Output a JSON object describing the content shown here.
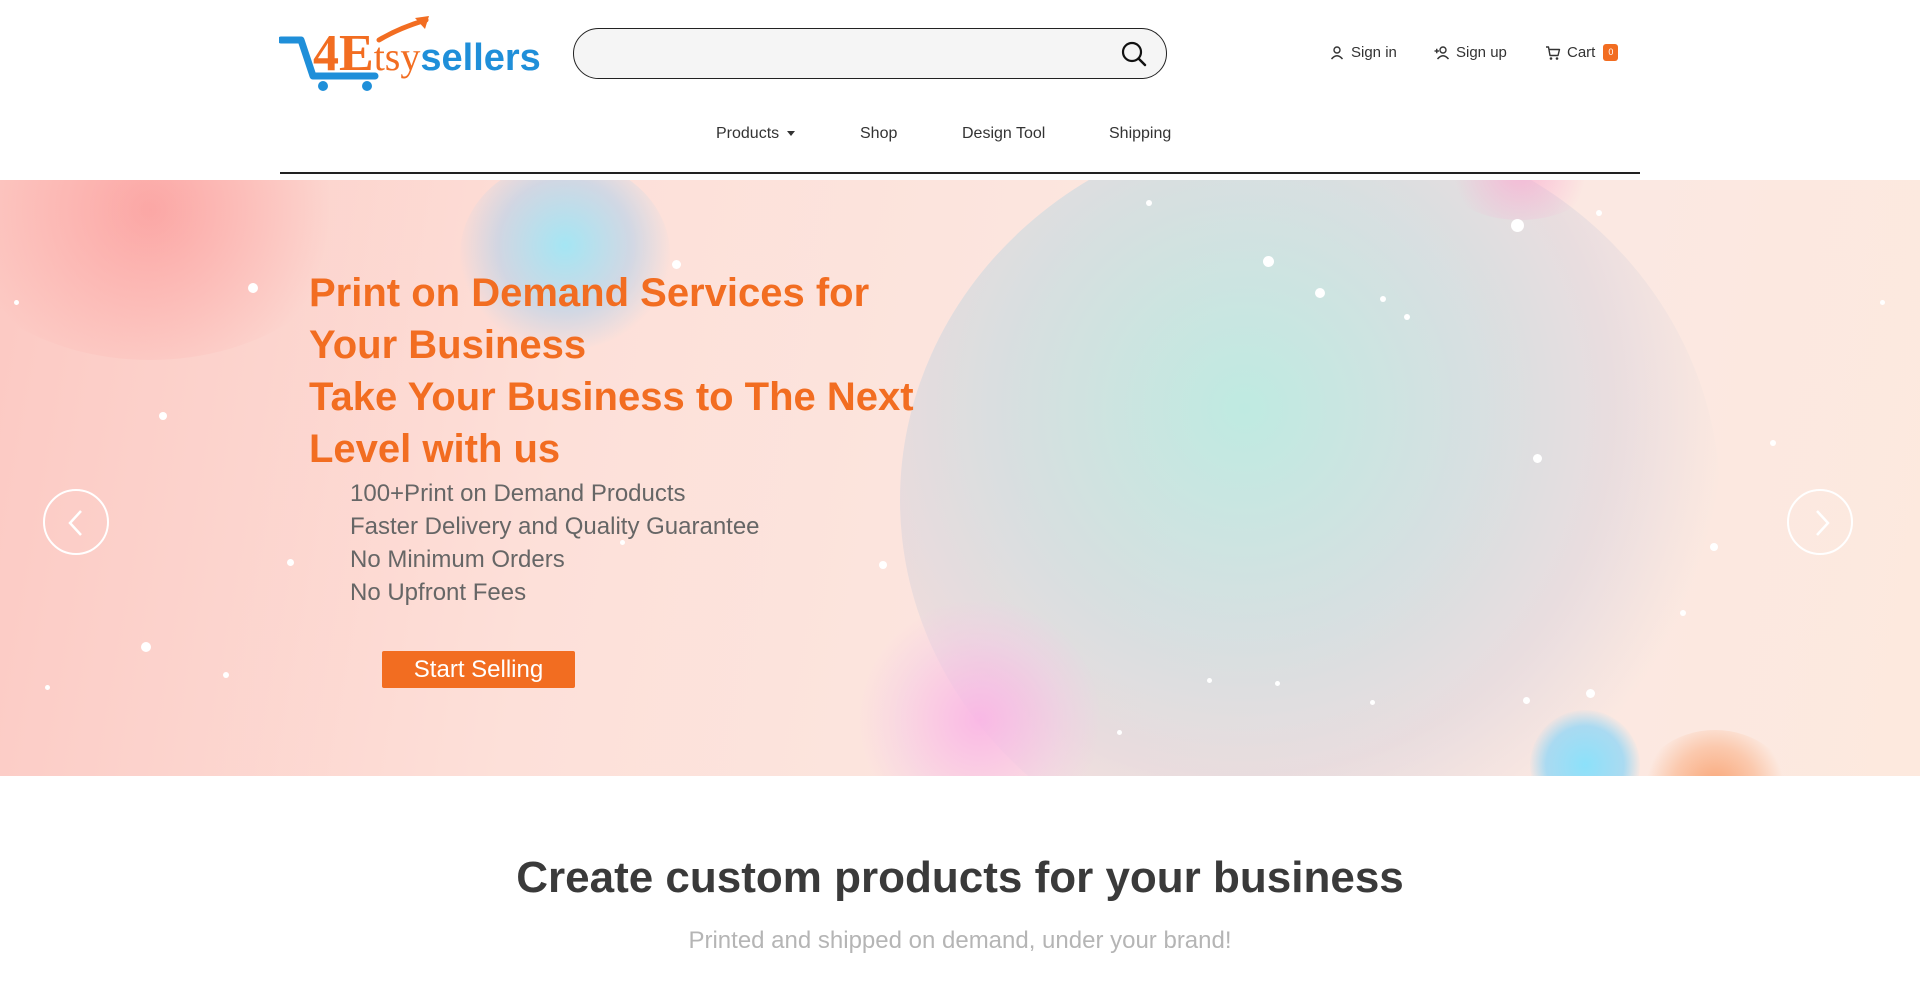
{
  "header": {
    "logo": {
      "number": "4",
      "letter": "E",
      "part1": "tsy",
      "part2": "sellers"
    },
    "search": {
      "placeholder": "",
      "value": "",
      "icon": "search-icon"
    },
    "user_links": {
      "sign_in": "Sign in",
      "sign_up": "Sign up",
      "cart": "Cart",
      "cart_count": "0"
    },
    "nav": {
      "products": "Products",
      "shop": "Shop",
      "design_tool": "Design Tool",
      "shipping": "Shipping"
    }
  },
  "hero": {
    "title_lines": [
      "Print on Demand Services for",
      "Your Business",
      "Take Your Business to The Next",
      "Level with us"
    ],
    "features": [
      "100+Print on Demand Products",
      "Faster Delivery and Quality Guarantee",
      "No Minimum Orders",
      "No Upfront Fees"
    ],
    "cta": "Start Selling",
    "prev_icon": "chevron-left-icon",
    "next_icon": "chevron-right-icon"
  },
  "section": {
    "title": "Create custom products for your business",
    "subtitle": "Printed and shipped on demand, under your brand!"
  },
  "colors": {
    "brand_orange": "#f26d21",
    "brand_blue": "#1f8fd9",
    "text_dark": "#333333",
    "subtitle_gray": "#b5b5b5"
  }
}
